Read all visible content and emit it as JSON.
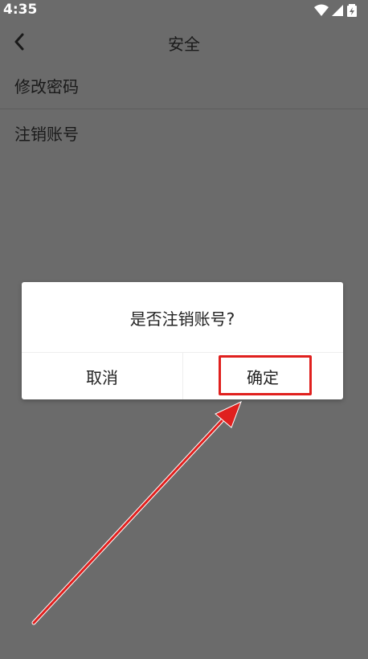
{
  "status_bar": {
    "time": "4:35",
    "icons": [
      "wifi-icon",
      "cell-signal-icon",
      "battery-icon"
    ]
  },
  "header": {
    "title": "安全",
    "back_icon": "back-arrow-icon"
  },
  "settings": {
    "items": [
      {
        "label": "修改密码"
      },
      {
        "label": "注销账号"
      }
    ]
  },
  "dialog": {
    "message": "是否注销账号?",
    "cancel_label": "取消",
    "confirm_label": "确定"
  },
  "annotation": {
    "highlight_color": "#e0201e",
    "arrow_color": "#e0201e"
  },
  "colors": {
    "overlay_background": "#6b6b6b",
    "dialog_background": "#ffffff"
  }
}
